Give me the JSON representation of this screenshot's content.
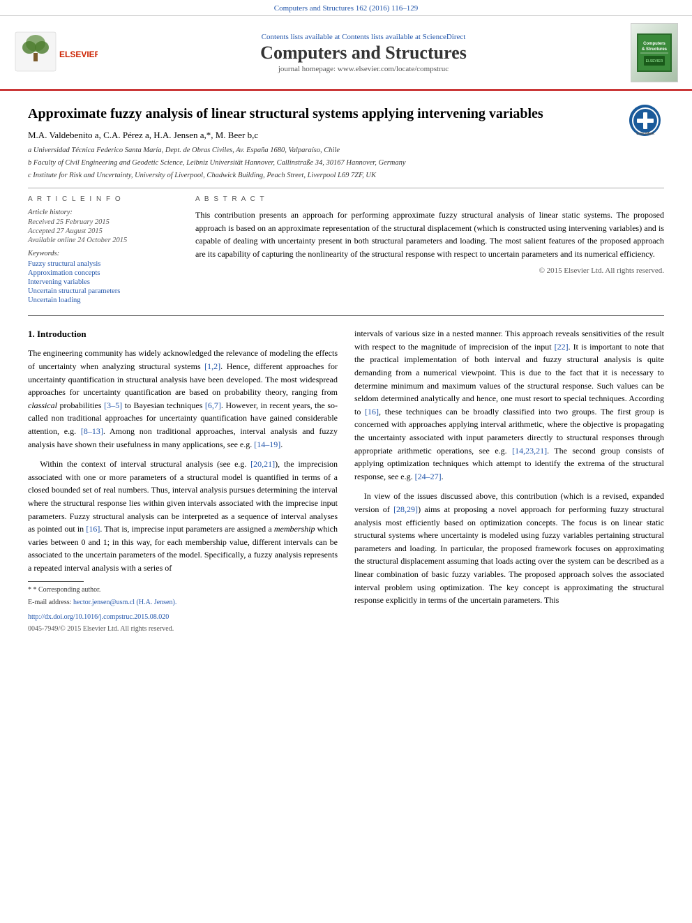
{
  "topbar": {
    "text": "Computers and Structures 162 (2016) 116–129"
  },
  "header": {
    "sciencedirect_text": "Contents lists available at ScienceDirect",
    "journal_title": "Computers and Structures",
    "homepage_text": "journal homepage: www.elsevier.com/locate/compstruc",
    "thumb_label": "Computers\n& Structures"
  },
  "article": {
    "title": "Approximate fuzzy analysis of linear structural systems applying intervening variables",
    "crossmark_label": "Cross\nMark",
    "authors": "M.A. Valdebenito",
    "authors_full": "M.A. Valdebenito a, C.A. Pérez a, H.A. Jensen a,*, M. Beer b,c",
    "affiliations": [
      "a Universidad Técnica Federico Santa María, Dept. de Obras Civiles, Av. España 1680, Valparaíso, Chile",
      "b Faculty of Civil Engineering and Geodetic Science, Leibniz Universität Hannover, Callinstraße 34, 30167 Hannover, Germany",
      "c Institute for Risk and Uncertainty, University of Liverpool, Chadwick Building, Peach Street, Liverpool L69 7ZF, UK"
    ],
    "article_info_heading": "A R T I C L E   I N F O",
    "history_heading": "Article history:",
    "history_items": [
      "Received 25 February 2015",
      "Accepted 27 August 2015",
      "Available online 24 October 2015"
    ],
    "keywords_heading": "Keywords:",
    "keywords": [
      "Fuzzy structural analysis",
      "Approximation concepts",
      "Intervening variables",
      "Uncertain structural parameters",
      "Uncertain loading"
    ],
    "abstract_heading": "A B S T R A C T",
    "abstract_text": "This contribution presents an approach for performing approximate fuzzy structural analysis of linear static systems. The proposed approach is based on an approximate representation of the structural displacement (which is constructed using intervening variables) and is capable of dealing with uncertainty present in both structural parameters and loading. The most salient features of the proposed approach are its capability of capturing the nonlinearity of the structural response with respect to uncertain parameters and its numerical efficiency.",
    "abstract_copyright": "© 2015 Elsevier Ltd. All rights reserved.",
    "section1_title": "1. Introduction",
    "intro_col1_p1": "The engineering community has widely acknowledged the relevance of modeling the effects of uncertainty when analyzing structural systems [1,2]. Hence, different approaches for uncertainty quantification in structural analysis have been developed. The most widespread approaches for uncertainty quantification are based on probability theory, ranging from classical probabilities [3–5] to Bayesian techniques [6,7]. However, in recent years, the so-called non traditional approaches for uncertainty quantification have gained considerable attention, e.g. [8–13]. Among non traditional approaches, interval analysis and fuzzy analysis have shown their usefulness in many applications, see e.g. [14–19].",
    "intro_col1_p2": "Within the context of interval structural analysis (see e.g. [20,21]), the imprecision associated with one or more parameters of a structural model is quantified in terms of a closed bounded set of real numbers. Thus, interval analysis pursues determining the interval where the structural response lies within given intervals associated with the imprecise input parameters. Fuzzy structural analysis can be interpreted as a sequence of interval analyses as pointed out in [16]. That is, imprecise input parameters are assigned a membership which varies between 0 and 1; in this way, for each membership value, different intervals can be associated to the uncertain parameters of the model. Specifically, a fuzzy analysis represents a repeated interval analysis with a series of",
    "intro_col2_p1": "intervals of various size in a nested manner. This approach reveals sensitivities of the result with respect to the magnitude of imprecision of the input [22]. It is important to note that the practical implementation of both interval and fuzzy structural analysis is quite demanding from a numerical viewpoint. This is due to the fact that it is necessary to determine minimum and maximum values of the structural response. Such values can be seldom determined analytically and hence, one must resort to special techniques. According to [16], these techniques can be broadly classified into two groups. The first group is concerned with approaches applying interval arithmetic, where the objective is propagating the uncertainty associated with input parameters directly to structural responses through appropriate arithmetic operations, see e.g. [14,23,21]. The second group consists of applying optimization techniques which attempt to identify the extrema of the structural response, see e.g. [24–27].",
    "intro_col2_p2": "In view of the issues discussed above, this contribution (which is a revised, expanded version of [28,29]) aims at proposing a novel approach for performing fuzzy structural analysis most efficiently based on optimization concepts. The focus is on linear static structural systems where uncertainty is modeled using fuzzy variables pertaining structural parameters and loading. In particular, the proposed framework focuses on approximating the structural displacement assuming that loads acting over the system can be described as a linear combination of basic fuzzy variables. The proposed approach solves the associated interval problem using optimization. The key concept is approximating the structural response explicitly in terms of the uncertain parameters. This",
    "footnote_star": "* Corresponding author.",
    "footnote_email_label": "E-mail address:",
    "footnote_email": "hector.jensen@usm.cl (H.A. Jensen).",
    "doi_line1": "http://dx.doi.org/10.1016/j.compstruc.2015.08.020",
    "doi_line2": "0045-7949/© 2015 Elsevier Ltd. All rights reserved.",
    "basic_word": "basic"
  }
}
